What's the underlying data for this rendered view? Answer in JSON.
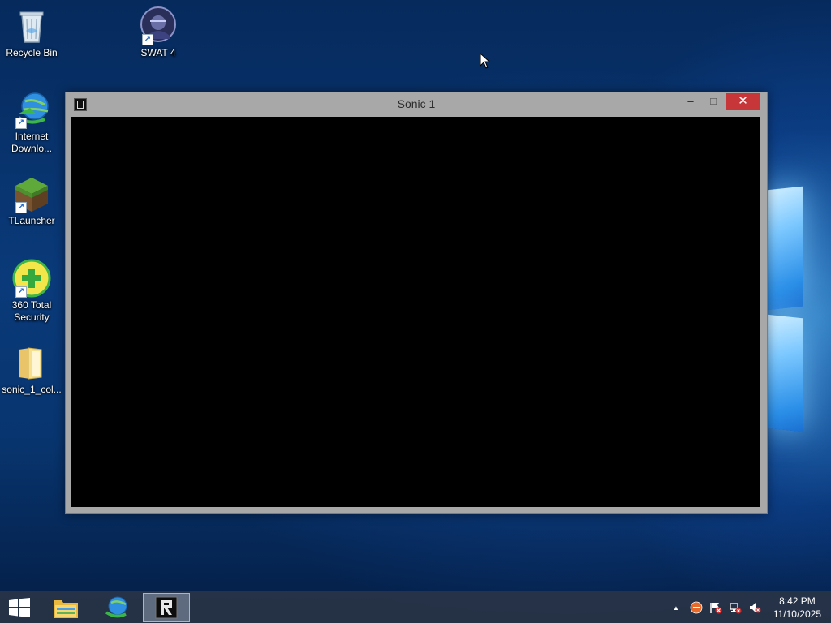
{
  "desktop": {
    "icons": [
      {
        "label": "Recycle Bin",
        "icon": "recycle-bin-icon",
        "shortcut": false
      },
      {
        "label": "SWAT 4",
        "icon": "swat4-icon",
        "shortcut": true
      },
      {
        "label": "Internet Downlo...",
        "icon": "internet-download-manager-icon",
        "shortcut": true
      },
      {
        "label": "TLauncher",
        "icon": "tlauncher-icon",
        "shortcut": true
      },
      {
        "label": "360 Total Security",
        "icon": "360-total-security-icon",
        "shortcut": true
      },
      {
        "label": "sonic_1_col...",
        "icon": "folder-icon",
        "shortcut": false
      }
    ]
  },
  "window": {
    "title": "Sonic 1",
    "app_icon": "sonic-app-icon",
    "controls": {
      "minimize": "–",
      "maximize": "☐",
      "close": "✕"
    }
  },
  "taskbar": {
    "start_icon": "windows-start-icon",
    "pinned": [
      {
        "name": "file-explorer",
        "icon": "file-explorer-icon"
      },
      {
        "name": "internet-download-manager",
        "icon": "internet-download-manager-icon"
      },
      {
        "name": "sonic-app",
        "icon": "sonic-app-icon",
        "active": true
      }
    ],
    "tray": {
      "chevron": "▲",
      "icons": [
        "360-security-tray-icon",
        "action-center-flag-icon",
        "network-icon",
        "volume-muted-icon"
      ]
    },
    "clock": {
      "time": "8:42 PM",
      "date": "11/10/2025"
    }
  },
  "colors": {
    "close_button": "#c7373a",
    "window_frame": "#a8a8a8",
    "taskbar": "#28344a"
  }
}
